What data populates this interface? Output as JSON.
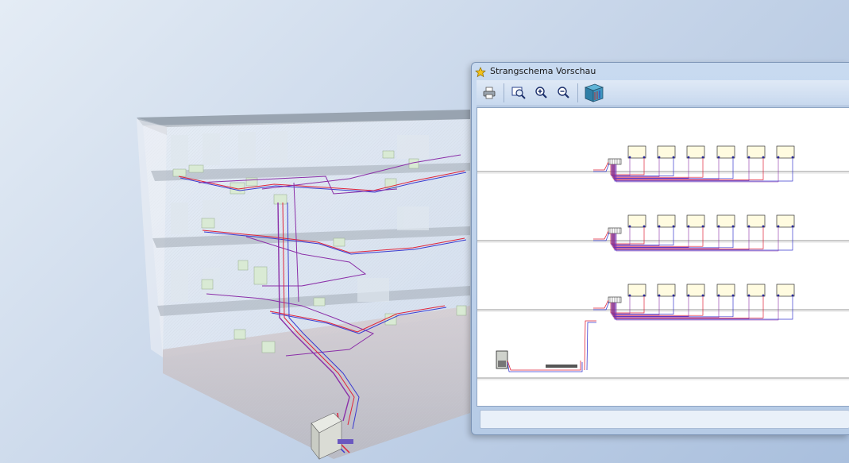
{
  "window": {
    "title": "Strangschema Vorschau",
    "icon": "star-icon"
  },
  "toolbar": {
    "buttons": [
      {
        "name": "print-button",
        "icon": "printer-icon"
      },
      {
        "name": "zoom-fit-button",
        "icon": "zoom-window-icon"
      },
      {
        "name": "zoom-in-button",
        "icon": "zoom-in-icon"
      },
      {
        "name": "zoom-out-button",
        "icon": "zoom-out-icon"
      },
      {
        "name": "view-3d-button",
        "icon": "building-3d-icon"
      }
    ]
  },
  "schema": {
    "floors": 3,
    "radiators_per_floor": 6
  },
  "status_bar": {
    "text": ""
  },
  "colors": {
    "pipe_supply": "#e0243a",
    "pipe_return": "#3b3bd0",
    "pipe_mixed": "#8b2fa8",
    "radiator_fill": "#fffbe0",
    "background_start": "#e4ecf5",
    "background_end": "#a9bfdd"
  }
}
